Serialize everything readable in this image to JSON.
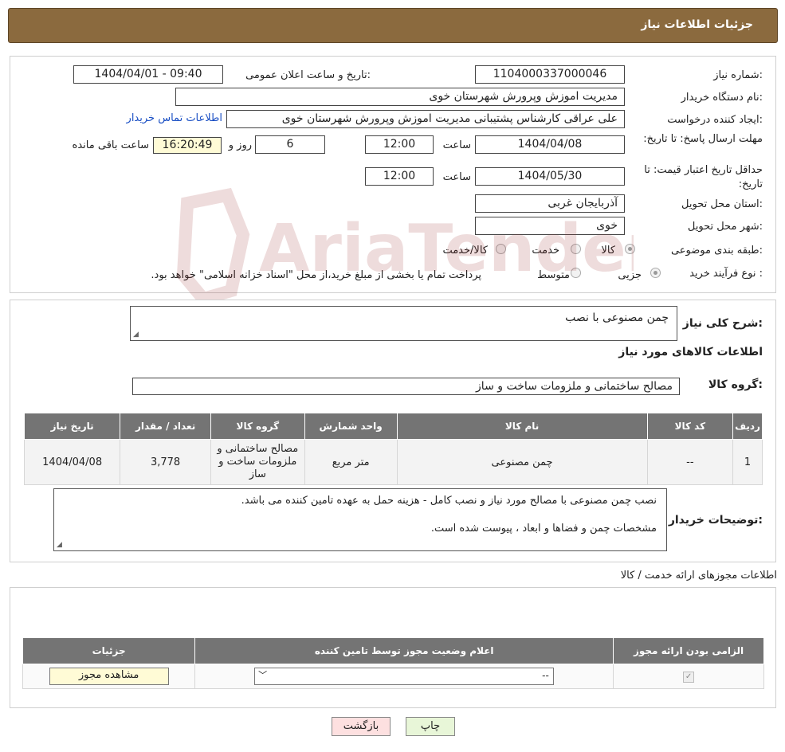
{
  "header": {
    "title": "جزئیات اطلاعات نیاز"
  },
  "details": {
    "need_number_label": "شماره نیاز:",
    "need_number": "1104000337000046",
    "announce_label": "تاریخ و ساعت اعلان عمومی:",
    "announce_value": "1404/04/01 - 09:40",
    "buyer_org_label": "نام دستگاه خریدار:",
    "buyer_org": "مدیریت اموزش وپرورش شهرستان خوی",
    "requester_label": "ایجاد کننده درخواست:",
    "requester": "علی عراقی کارشناس پشتیبانی مدیریت اموزش وپرورش شهرستان خوی",
    "contact_link": "اطلاعات تماس خریدار",
    "deadline_label": "مهلت ارسال پاسخ: تا تاریخ:",
    "deadline_date": "1404/04/08",
    "time_label": "ساعت",
    "deadline_time": "12:00",
    "days_value": "6",
    "days_label": "روز و",
    "remaining_time": "16:20:49",
    "remaining_label": "ساعت باقی مانده",
    "validity_label": "حداقل تاریخ اعتبار قیمت: تا تاریخ:",
    "validity_date": "1404/05/30",
    "validity_time": "12:00",
    "province_label": "استان محل تحویل:",
    "province": "آذربایجان غربی",
    "city_label": "شهر محل تحویل:",
    "city": "خوی",
    "category_label": "طبقه بندی موضوعی:",
    "category_options": [
      "کالا",
      "خدمت",
      "کالا/خدمت"
    ],
    "purchase_type_label": "نوع فرآیند خرید :",
    "purchase_options": [
      "جزیی",
      "متوسط"
    ],
    "purchase_note": "پرداخت تمام یا بخشی از مبلغ خرید،از محل \"اسناد خزانه اسلامی\" خواهد بود."
  },
  "watermark": {
    "text": "AriaTender.neT"
  },
  "summary": {
    "label": "شرح کلی نیاز:",
    "value": "چمن مصنوعی با نصب",
    "goods_info_title": "اطلاعات کالاهای مورد نیاز",
    "goods_group_label": "گروه کالا:",
    "goods_group_value": "مصالح ساختمانی و ملزومات ساخت و ساز"
  },
  "goods_table": {
    "headers": [
      "ردیف",
      "کد کالا",
      "نام کالا",
      "واحد شمارش",
      "گروه کالا",
      "تعداد / مقدار",
      "تاریخ نیاز"
    ],
    "rows": [
      [
        "1",
        "--",
        "چمن مصنوعی",
        "متر مربع",
        "مصالح ساختمانی و ملزومات ساخت و ساز",
        "3,778",
        "1404/04/08"
      ]
    ]
  },
  "buyer_notes": {
    "label": "توضیحات خریدار:",
    "line1": "نصب چمن مصنوعی با مصالح مورد نیاز و نصب کامل - هزینه حمل به عهده تامین کننده می باشد.",
    "line2": "مشخصات چمن و فضاها و ابعاد ، پیوست شده است."
  },
  "permits": {
    "title": "اطلاعات مجوزهای ارائه خدمت / کالا",
    "headers": [
      "الزامی بودن ارائه مجوز",
      "اعلام وضعیت مجوز توسط تامین کننده",
      "جزئیات"
    ],
    "select_value": "--",
    "view_button": "مشاهده مجوز"
  },
  "footer": {
    "print_button": "چاپ",
    "back_button": "بازگشت"
  },
  "colors": {
    "header_bg": "#8b6a3e",
    "table_header_bg": "#747474",
    "link": "#1a4fc4"
  }
}
